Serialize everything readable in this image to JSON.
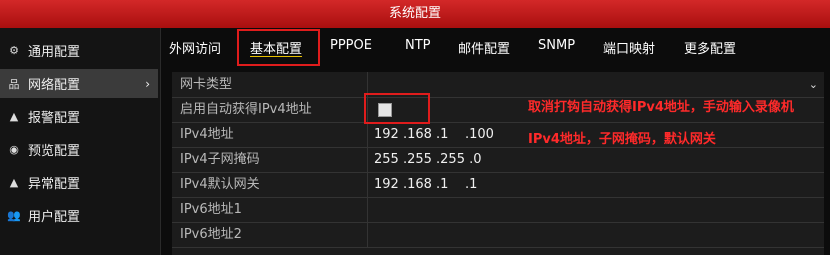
{
  "window": {
    "title": "系统配置"
  },
  "sidebar": {
    "items": [
      {
        "icon": "gear-icon",
        "glyph": "⚙",
        "label": "通用配置"
      },
      {
        "icon": "network-icon",
        "glyph": "品",
        "label": "网络配置",
        "chevron": "›"
      },
      {
        "icon": "alarm-icon",
        "glyph": "▲",
        "label": "报警配置"
      },
      {
        "icon": "eye-icon",
        "glyph": "◉",
        "label": "预览配置"
      },
      {
        "icon": "warning-icon",
        "glyph": "▲",
        "label": "异常配置"
      },
      {
        "icon": "users-icon",
        "glyph": "👥",
        "label": "用户配置"
      }
    ]
  },
  "tabs": [
    {
      "label": "外网访问"
    },
    {
      "label": "基本配置"
    },
    {
      "label": "PPPOE"
    },
    {
      "label": "NTP"
    },
    {
      "label": "邮件配置"
    },
    {
      "label": "SNMP"
    },
    {
      "label": "端口映射"
    },
    {
      "label": "更多配置"
    }
  ],
  "form": {
    "nic_type_label": "网卡类型",
    "dhcp_label": "启用自动获得IPv4地址",
    "ipv4_addr_label": "IPv4地址",
    "ipv4_addr_value": "192 .168 .1    .100",
    "ipv4_mask_label": "IPv4子网掩码",
    "ipv4_mask_value": "255 .255 .255 .0",
    "ipv4_gw_label": "IPv4默认网关",
    "ipv4_gw_value": "192 .168 .1    .1",
    "ipv6_addr1_label": "IPv6地址1",
    "ipv6_addr2_label": "IPv6地址2"
  },
  "annotation": {
    "text": "取消打钩自动获得IPv4地址，手动输入录像机IPv4地址，子网掩码，默认网关"
  },
  "colors": {
    "titlebar": "#c41a1a",
    "annotation": "#ff2a2a",
    "highlight_box": "#e01c1c"
  }
}
